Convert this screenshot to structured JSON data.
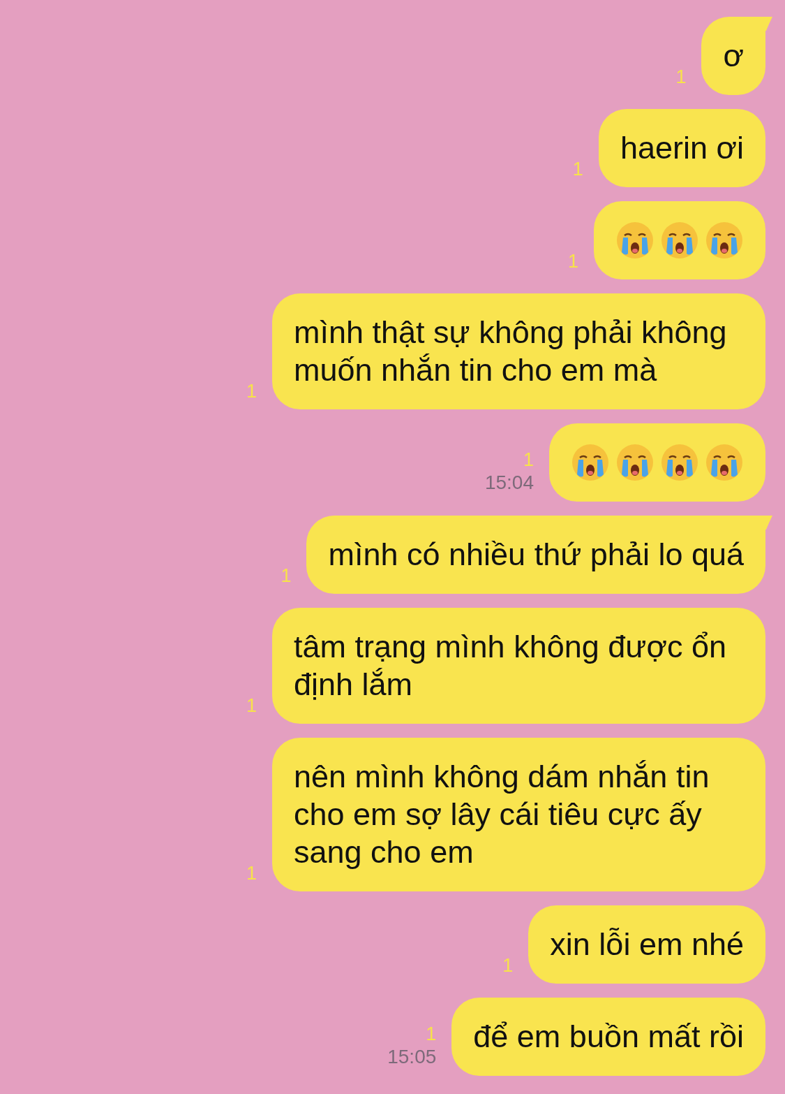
{
  "messages": [
    {
      "kind": "text",
      "text": "ơ",
      "unread": "1",
      "tail": true
    },
    {
      "kind": "text",
      "text": "haerin ơi",
      "unread": "1",
      "tail": false
    },
    {
      "kind": "emoji",
      "emojis": [
        {
          "kind": "crying"
        },
        {
          "kind": "crying"
        },
        {
          "kind": "crying"
        }
      ],
      "unread": "1",
      "tail": false
    },
    {
      "kind": "text",
      "text": "mình thật sự không phải không muốn nhắn tin cho em mà",
      "unread": "1",
      "tail": false
    },
    {
      "kind": "emoji",
      "emojis": [
        {
          "kind": "crying"
        },
        {
          "kind": "crying"
        },
        {
          "kind": "crying"
        },
        {
          "kind": "crying"
        }
      ],
      "unread": "1",
      "time": "15:04",
      "tail": false
    },
    {
      "kind": "text",
      "text": "mình có nhiều thứ phải lo quá",
      "unread": "1",
      "tail": true
    },
    {
      "kind": "text",
      "text": "tâm trạng mình không được ổn định lắm",
      "unread": "1",
      "tail": false
    },
    {
      "kind": "text",
      "text": "nên mình không dám nhắn tin cho em sợ lây cái tiêu cực ấy sang cho em",
      "unread": "1",
      "tail": false
    },
    {
      "kind": "text",
      "text": "xin lỗi em nhé",
      "unread": "1",
      "tail": false
    },
    {
      "kind": "text",
      "text": "để em buồn mất rồi",
      "unread": "1",
      "time": "15:05",
      "tail": false
    }
  ]
}
